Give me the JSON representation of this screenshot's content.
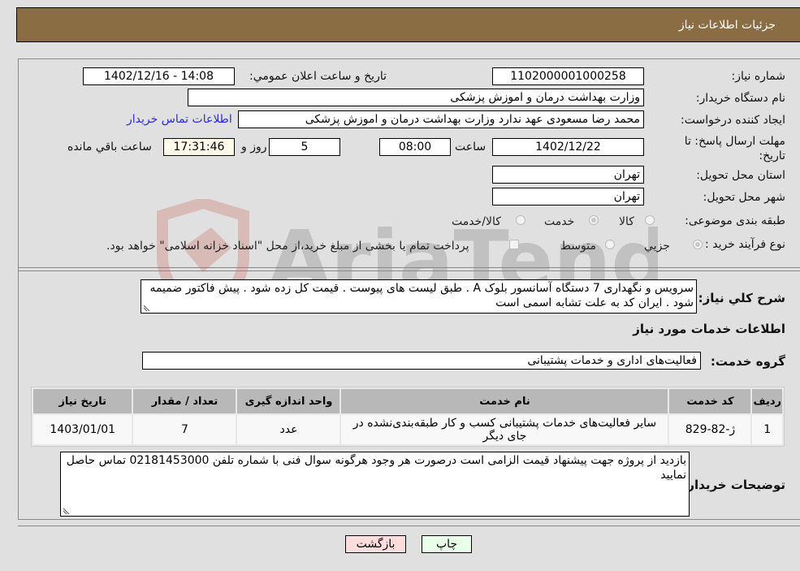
{
  "header": {
    "title": "جزئیات اطلاعات نیاز"
  },
  "fields": {
    "need_number": {
      "label": "شماره نیاز:",
      "value": "1102000001000258"
    },
    "announce_datetime": {
      "label": "تاریخ و ساعت اعلان عمومي:",
      "value": "1402/12/16 - 14:08"
    },
    "buyer_org": {
      "label": "نام دستگاه خریدار:",
      "value": "وزارت بهداشت  درمان و اموزش پزشکی"
    },
    "requester": {
      "label": "ایجاد کننده درخواست:",
      "value": "محمد رضا مسعودی عهد ندارد وزارت بهداشت  درمان و اموزش پزشکی"
    },
    "buyer_contact_link": "اطلاعات تماس خریدار",
    "deadline": {
      "label": "مهلت ارسال پاسخ: تا تاریخ:",
      "date": "1402/12/22",
      "time_label": "ساعت",
      "time": "08:00",
      "days": "5",
      "days_label": "روز و",
      "remaining": "17:31:46",
      "remaining_label": "ساعت باقي مانده"
    },
    "province": {
      "label": "استان محل تحویل:",
      "value": "تهران"
    },
    "city": {
      "label": "شهر محل تحویل:",
      "value": "تهران"
    },
    "category": {
      "label": "طبقه بندی موضوعی:",
      "options": [
        {
          "label": "کالا",
          "checked": false
        },
        {
          "label": "خدمت",
          "checked": true
        },
        {
          "label": "کالا/خدمت",
          "checked": false
        }
      ]
    },
    "purchase_type": {
      "label": "نوع فرآیند خرید :",
      "options": [
        {
          "label": "جزيي",
          "checked": true
        },
        {
          "label": "متوسط",
          "checked": false
        }
      ],
      "treasury_checkbox_label": "پرداخت تمام یا بخشی از مبلغ خرید،از محل \"اسناد خزانه اسلامی\" خواهد بود."
    },
    "description": {
      "label": "شرح کلي نیاز:",
      "value": "سرویس و نگهداری 7 دستگاه آسانسور بلوک A . طبق لیست های پیوست . قیمت کل زده شود . پیش فاکتور ضمیمه شود . ایران کد به علت تشابه اسمی است"
    }
  },
  "services": {
    "section_title": "اطلاعات خدمات مورد نیاز",
    "group_label": "گروه خدمت:",
    "group_value": "فعالیت‌های اداری و خدمات پشتیبانی",
    "table": {
      "headers": [
        "ردیف",
        "کد خدمت",
        "نام خدمت",
        "واحد اندازه گیری",
        "تعداد / مقدار",
        "تاریخ نیاز"
      ],
      "rows": [
        [
          "1",
          "ژ-82-829",
          "سایر فعالیت‌های خدمات پشتیبانی کسب و کار طبقه‌بندی‌نشده در جای دیگر",
          "عدد",
          "7",
          "1403/01/01"
        ]
      ]
    }
  },
  "buyer_notes": {
    "label": "توضیحات خریدار:",
    "value": "بازدید از پروژه جهت پیشنهاد قیمت الزامی است  درصورت هر وجود هرگونه سوال فنی با شماره تلفن 02181453000 تماس حاصل نمایید"
  },
  "buttons": {
    "print": "چاپ",
    "back": "بازگشت"
  },
  "watermark": {
    "text": "AriaTender.neT",
    "colors": {
      "shield": "#c0392b",
      "text": "#555555"
    }
  }
}
